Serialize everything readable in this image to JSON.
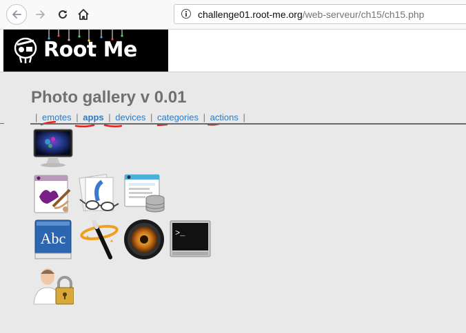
{
  "browser": {
    "url_host": "challenge01.root-me.org",
    "url_path": "/web-serveur/ch15/ch15.php"
  },
  "site": {
    "logo_text": "Root Me"
  },
  "page": {
    "title": "Photo gallery v 0.01",
    "menu": {
      "separator": "|",
      "items": [
        {
          "label": "emotes"
        },
        {
          "label": "apps"
        },
        {
          "label": "devices"
        },
        {
          "label": "categories"
        },
        {
          "label": "actions"
        }
      ],
      "active_item": "apps"
    }
  },
  "gallery": {
    "icons": [
      "monitor-icon",
      "paint-app-icon",
      "preview-glasses-icon",
      "database-app-icon",
      "dictionary-abc-icon",
      "magic-wand-icon",
      "aperture-camera-icon",
      "terminal-icon",
      "user-lock-icon"
    ]
  },
  "colors": {
    "link": "#2a7ac6",
    "title": "#707070",
    "annotation_red": "#e8201b"
  }
}
